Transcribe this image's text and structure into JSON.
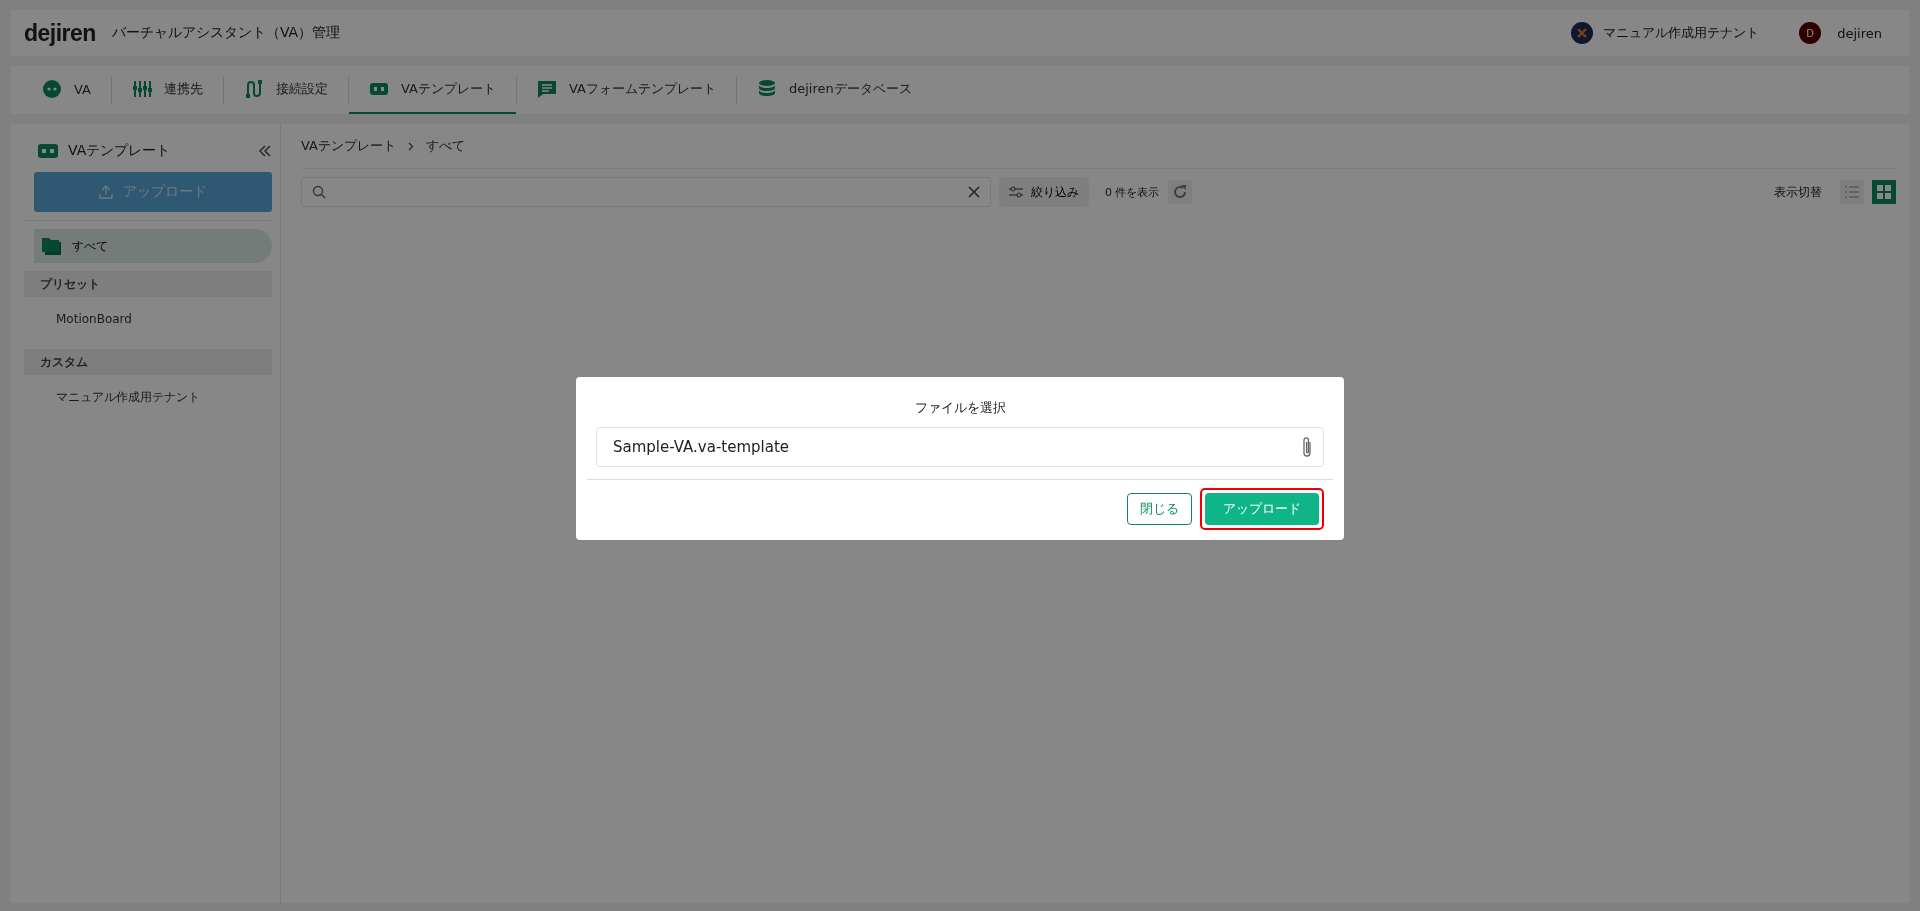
{
  "header": {
    "logo": "dejiren",
    "title": "バーチャルアシスタント（VA）管理",
    "tenant": "マニュアル作成用テナント",
    "user_initial": "D",
    "user": "dejiren"
  },
  "tabs": [
    {
      "kind": "va",
      "label": "VA",
      "selected": false
    },
    {
      "kind": "link",
      "label": "連携先",
      "selected": false
    },
    {
      "kind": "connect",
      "label": "接続設定",
      "selected": false
    },
    {
      "kind": "template",
      "label": "VAテンプレート",
      "selected": true
    },
    {
      "kind": "form",
      "label": "VAフォームテンプレート",
      "selected": false
    },
    {
      "kind": "db",
      "label": "dejirenデータベース",
      "selected": false
    }
  ],
  "sidebar": {
    "title": "VAテンプレート",
    "upload_button": "アップロード",
    "all_item": {
      "label": "すべて",
      "selected": true
    },
    "groups": [
      {
        "title": "プリセット",
        "items": [
          {
            "label": "MotionBoard",
            "selected": false
          }
        ]
      },
      {
        "title": "カスタム",
        "items": [
          {
            "label": "マニュアル作成用テナント",
            "selected": false
          }
        ]
      }
    ]
  },
  "breadcrumb": [
    "VAテンプレート",
    "すべて"
  ],
  "toolbar": {
    "filter_button": "絞り込み",
    "count": "0 件を表示",
    "view_toggle_label": "表示切替",
    "views": [
      {
        "kind": "list",
        "selected": false
      },
      {
        "kind": "grid",
        "selected": true
      }
    ]
  },
  "dialog": {
    "title": "ファイルを選択",
    "file_value": "Sample-VA.va-template",
    "buttons": [
      {
        "kind": "close",
        "label": "閉じる",
        "highlighted": false
      },
      {
        "kind": "primary",
        "label": "アップロード",
        "highlighted": true
      }
    ]
  }
}
